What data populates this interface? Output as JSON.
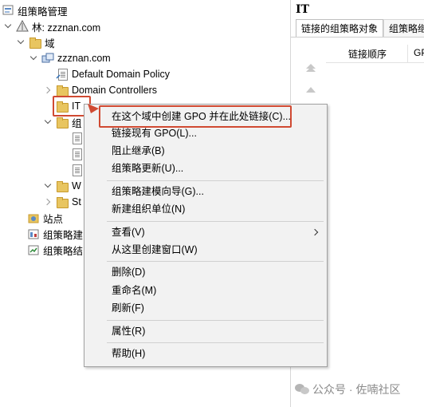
{
  "window": {
    "title": "组策略管理"
  },
  "tree": {
    "forest": "林: zzznan.com",
    "domains": "域",
    "domain": "zzznan.com",
    "default_domain_policy": "Default Domain Policy",
    "domain_controllers": "Domain Controllers",
    "ou_it": "IT",
    "group_policy_objects": "组",
    "wmi_filters": "W",
    "starter_gpos": "St",
    "sites": "站点",
    "modeling": "组策略建",
    "results": "组策略结"
  },
  "right_pane": {
    "title": "IT",
    "tabs": [
      "链接的组策略对象",
      "组策略继"
    ],
    "columns": [
      "链接顺序",
      "GP"
    ]
  },
  "context_menu": {
    "items": [
      {
        "label": "在这个域中创建 GPO 并在此处链接(C)..."
      },
      {
        "label": "链接现有 GPO(L)..."
      },
      {
        "label": "阻止继承(B)"
      },
      {
        "label": "组策略更新(U)..."
      },
      {
        "label": "组策略建模向导(G)..."
      },
      {
        "label": "新建组织单位(N)"
      },
      {
        "label": "查看(V)"
      },
      {
        "label": "从这里创建窗口(W)"
      },
      {
        "label": "删除(D)"
      },
      {
        "label": "重命名(M)"
      },
      {
        "label": "刷新(F)"
      },
      {
        "label": "属性(R)"
      },
      {
        "label": "帮助(H)"
      }
    ]
  },
  "watermark": {
    "text": "公众号 · 佐喃社区"
  },
  "colors": {
    "highlight": "#d04a32",
    "menu_bg": "#f2f2f2",
    "folder": "#e8c560"
  }
}
